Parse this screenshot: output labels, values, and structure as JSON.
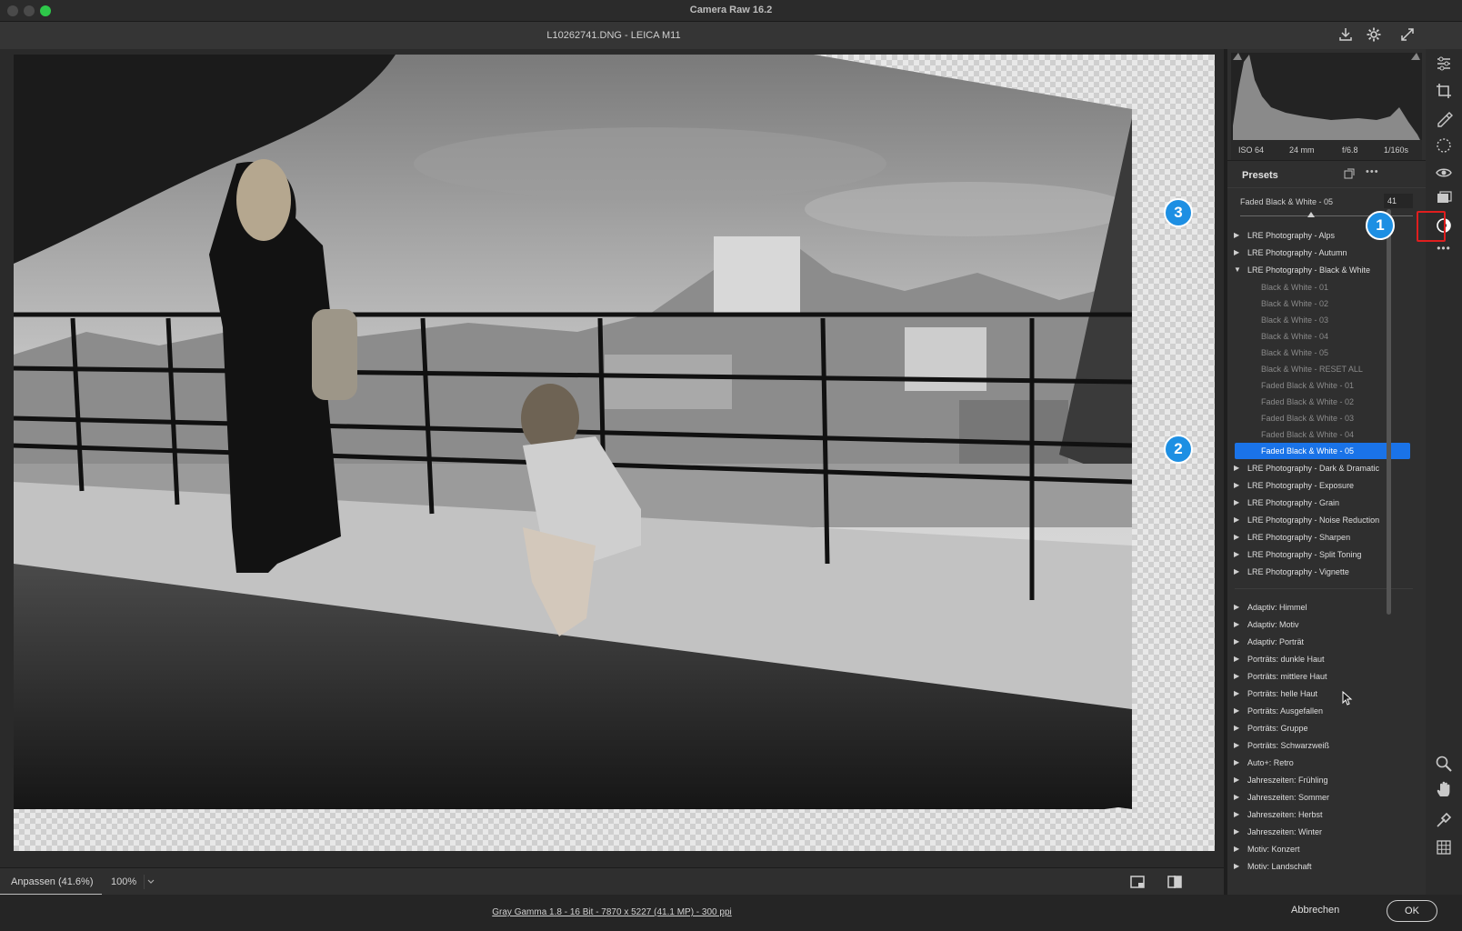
{
  "window": {
    "app_title": "Camera Raw 16.2",
    "filename": "L10262741.DNG - LEICA M11"
  },
  "canvas": {
    "zoom_fit_label": "Anpassen (41.6%)",
    "zoom_100_label": "100%"
  },
  "status": {
    "workflow_text": "Gray Gamma 1.8 - 16 Bit - 7870 x 5227 (41.1 MP) - 300 ppi",
    "cancel_label": "Abbrechen",
    "ok_label": "OK"
  },
  "exif": {
    "iso": "ISO 64",
    "focal": "24 mm",
    "aperture": "f/6.8",
    "shutter": "1/160s"
  },
  "presets": {
    "title": "Presets",
    "amount_label": "Faded Black & White - 05",
    "amount_value": "41",
    "amount_fraction": 0.41
  },
  "preset_groups": [
    {
      "label": "LRE Photography - Alps",
      "expanded": false
    },
    {
      "label": "LRE Photography - Autumn",
      "expanded": false
    },
    {
      "label": "LRE Photography - Black & White",
      "expanded": true,
      "children": [
        "Black & White - 01",
        "Black & White - 02",
        "Black & White - 03",
        "Black & White - 04",
        "Black & White - 05",
        "Black & White - RESET ALL",
        "Faded Black & White - 01",
        "Faded Black & White - 02",
        "Faded Black & White - 03",
        "Faded Black & White - 04",
        "Faded Black & White - 05"
      ],
      "selected_child": "Faded Black & White - 05"
    },
    {
      "label": "LRE Photography - Dark & Dramatic",
      "expanded": false
    },
    {
      "label": "LRE Photography - Exposure",
      "expanded": false
    },
    {
      "label": "LRE Photography - Grain",
      "expanded": false
    },
    {
      "label": "LRE Photography - Noise Reduction",
      "expanded": false
    },
    {
      "label": "LRE Photography - Sharpen",
      "expanded": false
    },
    {
      "label": "LRE Photography - Split Toning",
      "expanded": false
    },
    {
      "label": "LRE Photography - Vignette",
      "expanded": false
    }
  ],
  "builtin_groups": [
    "Adaptiv: Himmel",
    "Adaptiv: Motiv",
    "Adaptiv: Porträt",
    "Porträts: dunkle Haut",
    "Porträts: mittlere Haut",
    "Porträts: helle Haut",
    "Porträts: Ausgefallen",
    "Porträts: Gruppe",
    "Porträts: Schwarzweiß",
    "Auto+: Retro",
    "Jahreszeiten: Frühling",
    "Jahreszeiten: Sommer",
    "Jahreszeiten: Herbst",
    "Jahreszeiten: Winter",
    "Motiv: Konzert",
    "Motiv: Landschaft"
  ],
  "callouts": [
    "1",
    "2",
    "3"
  ],
  "colors": {
    "selection": "#1a73e8",
    "callout": "#1d8fe3",
    "highlight_box": "#e01e1e"
  },
  "icons": {
    "toolstrip": [
      "edit-sliders-icon",
      "crop-icon",
      "healing-icon",
      "masking-icon",
      "redeye-icon",
      "snapshots-icon",
      "presets-icon",
      "more-icon",
      "zoom-icon",
      "hand-icon",
      "sampler-icon",
      "grid-icon"
    ]
  }
}
